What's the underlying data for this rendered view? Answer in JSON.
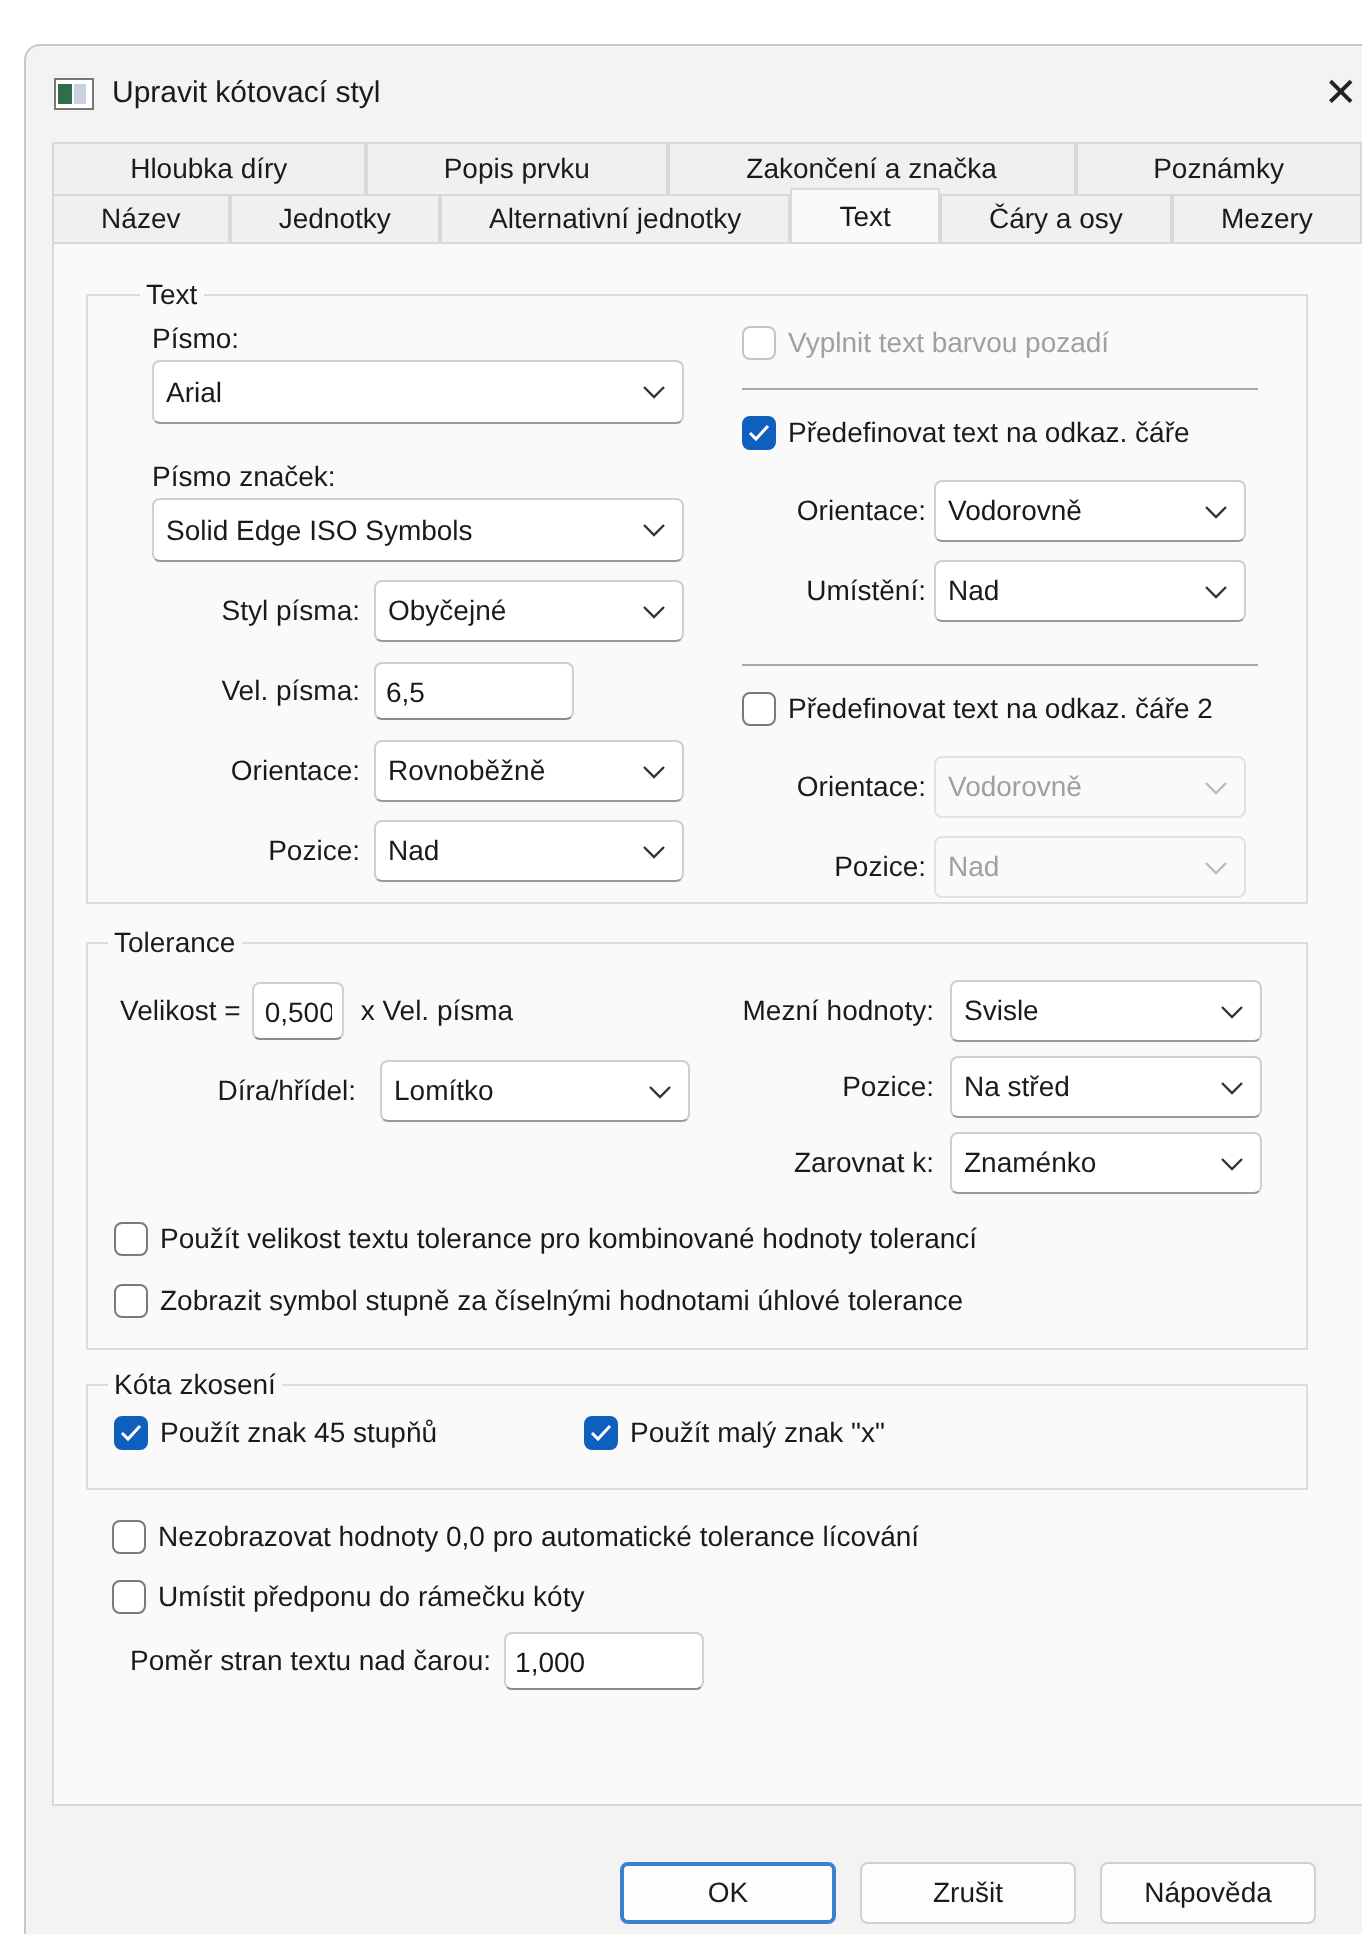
{
  "window": {
    "title": "Upravit kótovací styl",
    "close": "✕"
  },
  "tab_rows": [
    [
      {
        "label": "Hloubka díry",
        "selected": false
      },
      {
        "label": "Popis prvku",
        "selected": false
      },
      {
        "label": "Zakončení a značka",
        "selected": false
      },
      {
        "label": "Poznámky",
        "selected": false
      }
    ],
    [
      {
        "label": "Název",
        "selected": false
      },
      {
        "label": "Jednotky",
        "selected": false
      },
      {
        "label": "Alternativní jednotky",
        "selected": false
      },
      {
        "label": "Text",
        "selected": true
      },
      {
        "label": "Čáry a osy",
        "selected": false
      },
      {
        "label": "Mezery",
        "selected": false
      }
    ]
  ],
  "text_group": {
    "title": "Text",
    "left": [
      {
        "kind": "stacked",
        "label": "Písmo:",
        "value": "Arial",
        "disabled": false
      },
      {
        "kind": "stacked",
        "label": "Písmo značek:",
        "value": "Solid Edge ISO Symbols",
        "disabled": false
      },
      {
        "kind": "combo",
        "label": "Styl písma:",
        "value": "Obyčejné",
        "disabled": false
      },
      {
        "kind": "input",
        "label": "Vel. písma:",
        "value": "6,5"
      },
      {
        "kind": "combo",
        "label": "Orientace:",
        "value": "Rovnoběžně",
        "disabled": false
      },
      {
        "kind": "combo",
        "label": "Pozice:",
        "value": "Nad",
        "disabled": false
      }
    ],
    "right": [
      {
        "kind": "checkbox",
        "label": "Vyplnit text barvou pozadí",
        "checked": false,
        "disabled": true
      },
      {
        "kind": "separator"
      },
      {
        "kind": "checkbox",
        "label": "Předefinovat text na odkaz. čáře",
        "checked": true,
        "disabled": false
      },
      {
        "kind": "combo",
        "label": "Orientace:",
        "value": "Vodorovně",
        "disabled": false
      },
      {
        "kind": "combo",
        "label": "Umístění:",
        "value": "Nad",
        "disabled": false
      },
      {
        "kind": "separator"
      },
      {
        "kind": "checkbox",
        "label": "Předefinovat text na odkaz. čáře 2",
        "checked": false,
        "disabled": false
      },
      {
        "kind": "combo",
        "label": "Orientace:",
        "value": "Vodorovně",
        "disabled": true
      },
      {
        "kind": "combo",
        "label": "Pozice:",
        "value": "Nad",
        "disabled": true
      }
    ]
  },
  "tolerance_group": {
    "title": "Tolerance",
    "left": [
      {
        "kind": "scale",
        "label": "Velikost =",
        "value": "0,500",
        "suffix": "x Vel. písma"
      },
      {
        "kind": "combo",
        "label": "Díra/hřídel:",
        "value": "Lomítko",
        "disabled": false
      }
    ],
    "right": [
      {
        "kind": "combo",
        "label": "Mezní hodnoty:",
        "value": "Svisle",
        "disabled": false
      },
      {
        "kind": "combo",
        "label": "Pozice:",
        "value": "Na střed",
        "disabled": false
      },
      {
        "kind": "combo",
        "label": "Zarovnat k:",
        "value": "Znaménko",
        "disabled": false
      }
    ],
    "checkboxes": [
      {
        "label": "Použít velikost textu tolerance pro kombinované hodnoty tolerancí",
        "checked": false,
        "disabled": false
      },
      {
        "label": "Zobrazit symbol stupně za číselnými hodnotami úhlové tolerance",
        "checked": false,
        "disabled": false
      }
    ]
  },
  "chamfer_group": {
    "title": "Kóta zkosení",
    "checkboxes": [
      {
        "label": "Použít znak 45 stupňů",
        "checked": true,
        "disabled": false
      },
      {
        "label": "Použít malý znak \"x\"",
        "checked": true,
        "disabled": false
      }
    ]
  },
  "checkboxes": [
    {
      "label": "Nezobrazovat hodnoty 0,0 pro automatické tolerance lícování",
      "checked": false,
      "disabled": false
    },
    {
      "label": "Umístit předponu do rámečku kóty",
      "checked": false,
      "disabled": false
    }
  ],
  "aspect_ratio": {
    "label": "Poměr stran textu nad čarou:",
    "value": "1,000"
  },
  "buttons": [
    {
      "label": "OK",
      "default": true
    },
    {
      "label": "Zrušit",
      "default": false
    },
    {
      "label": "Nápověda",
      "default": false
    }
  ]
}
